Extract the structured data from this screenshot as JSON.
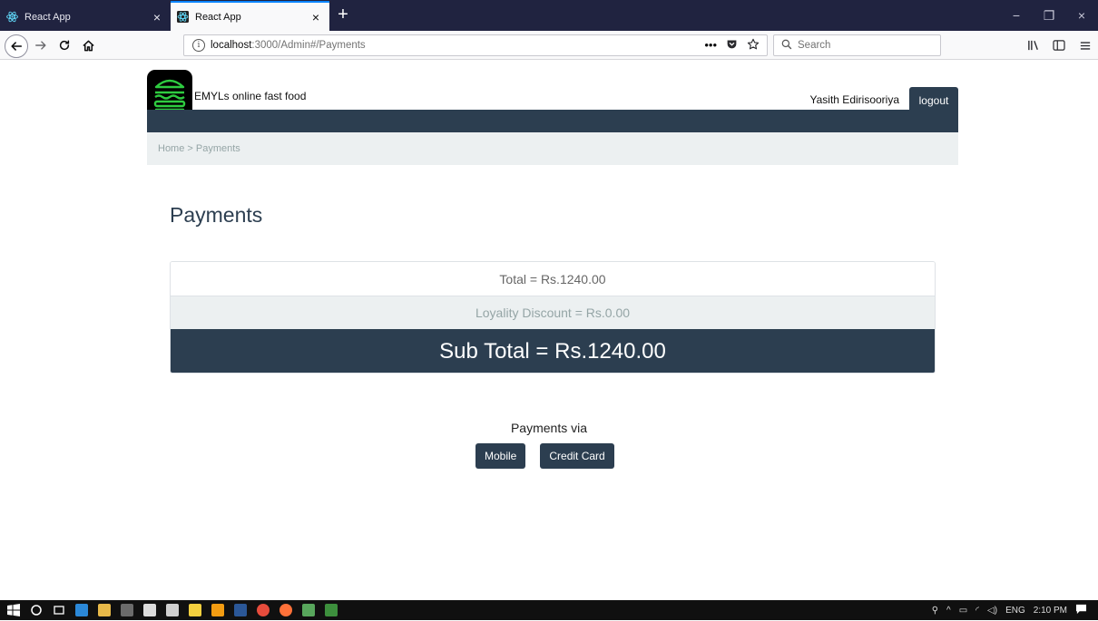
{
  "browser": {
    "tabs": [
      {
        "title": "React App",
        "active": false
      },
      {
        "title": "React App",
        "active": true
      }
    ],
    "new_tab_symbol": "+",
    "close_symbol": "×",
    "window_controls": {
      "minimize": "−",
      "restore": "❐",
      "close": "×"
    },
    "url": {
      "host": "localhost",
      "rest": ":3000/Admin#/Payments"
    },
    "url_actions": [
      "•••",
      "shield-icon",
      "star-icon"
    ],
    "search_placeholder": "Search",
    "accent": "#0a84ff",
    "tabstrip_color": "#202340"
  },
  "header": {
    "brand_name": "EMYLs online fast food",
    "user_name": "Yasith Edirisooriya",
    "logout_label": "logout",
    "logo_icon": "burger-icon",
    "primary_color": "#2c3e50"
  },
  "breadcrumb": {
    "text": "Home > Payments"
  },
  "payments": {
    "title": "Payments",
    "total_text": "Total = Rs.1240.00",
    "discount_text": "Loyality Discount = Rs.0.00",
    "subtotal_text": "Sub Total = Rs.1240.00",
    "via_label": "Payments via",
    "mobile_label": "Mobile",
    "credit_card_label": "Credit Card"
  },
  "taskbar": {
    "apps": [
      "windows-start-icon",
      "cortana-icon",
      "task-view-icon",
      "edge-icon",
      "file-explorer-icon",
      "terminal-icon",
      "store-icon",
      "mail-icon",
      "sticky-notes-icon",
      "vlc-icon",
      "word-icon",
      "chrome-icon",
      "firefox-icon",
      "notepad-icon",
      "download-icon"
    ],
    "tray": {
      "language": "ENG",
      "time": "2:10 PM"
    }
  }
}
